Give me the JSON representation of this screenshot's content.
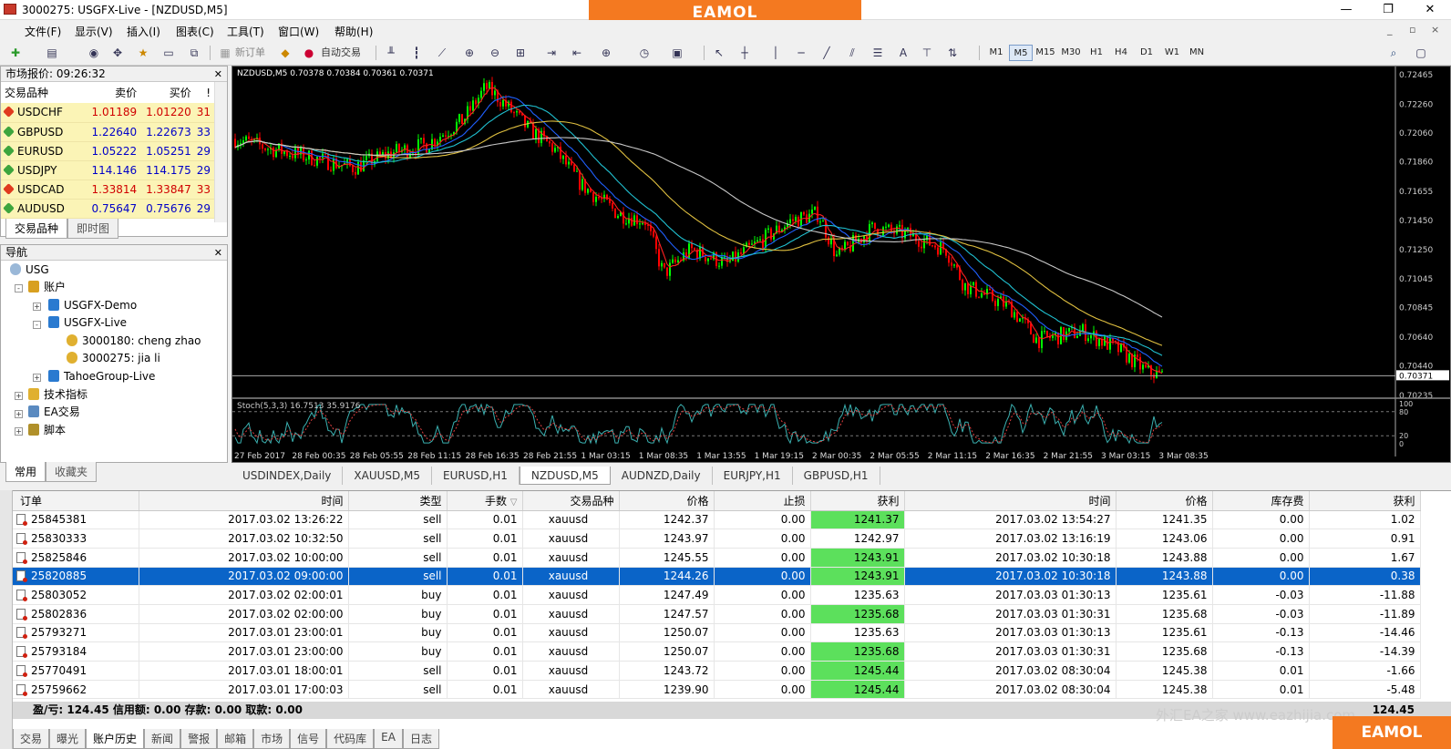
{
  "window": {
    "title": "3000275: USGFX-Live - [NZDUSD,M5]",
    "brand": "EAMOL",
    "min": "—",
    "restore": "❐",
    "close": "✕"
  },
  "menu": [
    "文件(F)",
    "显示(V)",
    "插入(I)",
    "图表(C)",
    "工具(T)",
    "窗口(W)",
    "帮助(H)"
  ],
  "mdi": [
    "_",
    "▫",
    "×"
  ],
  "toolbar": {
    "new_order": "新订单",
    "auto_trading": "自动交易",
    "text_tool": "A",
    "timeframes": [
      "M1",
      "M5",
      "M15",
      "M30",
      "H1",
      "H4",
      "D1",
      "W1",
      "MN"
    ],
    "active_timeframe": "M5"
  },
  "market_watch": {
    "title": "市场报价: 09:26:32",
    "headers": [
      "交易品种",
      "卖价",
      "买价",
      "!"
    ],
    "rows": [
      {
        "symbol": "USDCHF",
        "bid": "1.01189",
        "ask": "1.01220",
        "spread": "31",
        "dir": "down"
      },
      {
        "symbol": "GBPUSD",
        "bid": "1.22640",
        "ask": "1.22673",
        "spread": "33",
        "dir": "up"
      },
      {
        "symbol": "EURUSD",
        "bid": "1.05222",
        "ask": "1.05251",
        "spread": "29",
        "dir": "up"
      },
      {
        "symbol": "USDJPY",
        "bid": "114.146",
        "ask": "114.175",
        "spread": "29",
        "dir": "up"
      },
      {
        "symbol": "USDCAD",
        "bid": "1.33814",
        "ask": "1.33847",
        "spread": "33",
        "dir": "down"
      },
      {
        "symbol": "AUDUSD",
        "bid": "0.75647",
        "ask": "0.75676",
        "spread": "29",
        "dir": "up"
      }
    ],
    "tabs": [
      "交易品种",
      "即时图"
    ]
  },
  "navigator": {
    "title": "导航",
    "items": [
      "USG",
      "账户",
      "USGFX-Demo",
      "USGFX-Live",
      "3000180: cheng zhao",
      "3000275: jia li",
      "TahoeGroup-Live",
      "技术指标",
      "EA交易",
      "脚本"
    ],
    "tabs": [
      "常用",
      "收藏夹"
    ]
  },
  "chart": {
    "header": "NZDUSD,M5  0.70378 0.70384 0.70361 0.70371",
    "stoch_label": "Stoch(5,3,3) 16.7513 35.9176",
    "price_labels": [
      "0.72465",
      "0.72260",
      "0.72060",
      "0.71860",
      "0.71655",
      "0.71450",
      "0.71250",
      "0.71045",
      "0.70845",
      "0.70640",
      "0.70440",
      "0.70235"
    ],
    "current_price": "0.70371",
    "stoch_levels": [
      "100",
      "80",
      "20",
      "0"
    ],
    "time_labels": [
      "27 Feb 2017",
      "28 Feb 00:35",
      "28 Feb 05:55",
      "28 Feb 11:15",
      "28 Feb 16:35",
      "28 Feb 21:55",
      "1 Mar 03:15",
      "1 Mar 08:35",
      "1 Mar 13:55",
      "1 Mar 19:15",
      "2 Mar 00:35",
      "2 Mar 05:55",
      "2 Mar 11:15",
      "2 Mar 16:35",
      "2 Mar 21:55",
      "3 Mar 03:15",
      "3 Mar 08:35"
    ],
    "up_color": "#00ff00",
    "down_color": "#ff0000",
    "ma_colors": [
      "#ff2020",
      "#2060ff",
      "#20c0d0",
      "#e0c040",
      "#c8c8c8"
    ]
  },
  "chart_tabs": [
    "USDINDEX,Daily",
    "XAUUSD,M5",
    "EURUSD,H1",
    "NZDUSD,M5",
    "AUDNZD,Daily",
    "EURJPY,H1",
    "GBPUSD,H1"
  ],
  "active_chart_tab": "NZDUSD,M5",
  "terminal": {
    "headers": [
      "订单",
      "时间",
      "类型",
      "手数",
      "交易品种",
      "价格",
      "止损",
      "获利",
      "时间",
      "价格",
      "库存费",
      "获利"
    ],
    "sort_mark": "▽",
    "rows": [
      {
        "order": "25845381",
        "open_time": "2017.03.02 13:26:22",
        "type": "sell",
        "lots": "0.01",
        "symbol": "xauusd",
        "open_price": "1242.37",
        "sl": "0.00",
        "tp": "1241.37",
        "close_time": "2017.03.02 13:54:27",
        "close_price": "1241.35",
        "swap": "0.00",
        "profit": "1.02",
        "hl": true
      },
      {
        "order": "25830333",
        "open_time": "2017.03.02 10:32:50",
        "type": "sell",
        "lots": "0.01",
        "symbol": "xauusd",
        "open_price": "1243.97",
        "sl": "0.00",
        "tp": "1242.97",
        "close_time": "2017.03.02 13:16:19",
        "close_price": "1243.06",
        "swap": "0.00",
        "profit": "0.91",
        "hl": false
      },
      {
        "order": "25825846",
        "open_time": "2017.03.02 10:00:00",
        "type": "sell",
        "lots": "0.01",
        "symbol": "xauusd",
        "open_price": "1245.55",
        "sl": "0.00",
        "tp": "1243.91",
        "close_time": "2017.03.02 10:30:18",
        "close_price": "1243.88",
        "swap": "0.00",
        "profit": "1.67",
        "hl": true
      },
      {
        "order": "25820885",
        "open_time": "2017.03.02 09:00:00",
        "type": "sell",
        "lots": "0.01",
        "symbol": "xauusd",
        "open_price": "1244.26",
        "sl": "0.00",
        "tp": "1243.91",
        "close_time": "2017.03.02 10:30:18",
        "close_price": "1243.88",
        "swap": "0.00",
        "profit": "0.38",
        "hl": true,
        "selected": true
      },
      {
        "order": "25803052",
        "open_time": "2017.03.02 02:00:01",
        "type": "buy",
        "lots": "0.01",
        "symbol": "xauusd",
        "open_price": "1247.49",
        "sl": "0.00",
        "tp": "1235.63",
        "close_time": "2017.03.03 01:30:13",
        "close_price": "1235.61",
        "swap": "-0.03",
        "profit": "-11.88",
        "hl": false
      },
      {
        "order": "25802836",
        "open_time": "2017.03.02 02:00:00",
        "type": "buy",
        "lots": "0.01",
        "symbol": "xauusd",
        "open_price": "1247.57",
        "sl": "0.00",
        "tp": "1235.68",
        "close_time": "2017.03.03 01:30:31",
        "close_price": "1235.68",
        "swap": "-0.03",
        "profit": "-11.89",
        "hl": true
      },
      {
        "order": "25793271",
        "open_time": "2017.03.01 23:00:01",
        "type": "buy",
        "lots": "0.01",
        "symbol": "xauusd",
        "open_price": "1250.07",
        "sl": "0.00",
        "tp": "1235.63",
        "close_time": "2017.03.03 01:30:13",
        "close_price": "1235.61",
        "swap": "-0.13",
        "profit": "-14.46",
        "hl": false
      },
      {
        "order": "25793184",
        "open_time": "2017.03.01 23:00:00",
        "type": "buy",
        "lots": "0.01",
        "symbol": "xauusd",
        "open_price": "1250.07",
        "sl": "0.00",
        "tp": "1235.68",
        "close_time": "2017.03.03 01:30:31",
        "close_price": "1235.68",
        "swap": "-0.13",
        "profit": "-14.39",
        "hl": true
      },
      {
        "order": "25770491",
        "open_time": "2017.03.01 18:00:01",
        "type": "sell",
        "lots": "0.01",
        "symbol": "xauusd",
        "open_price": "1243.72",
        "sl": "0.00",
        "tp": "1245.44",
        "close_time": "2017.03.02 08:30:04",
        "close_price": "1245.38",
        "swap": "0.01",
        "profit": "-1.66",
        "hl": true
      },
      {
        "order": "25759662",
        "open_time": "2017.03.01 17:00:03",
        "type": "sell",
        "lots": "0.01",
        "symbol": "xauusd",
        "open_price": "1239.90",
        "sl": "0.00",
        "tp": "1245.44",
        "close_time": "2017.03.02 08:30:04",
        "close_price": "1245.38",
        "swap": "0.01",
        "profit": "-5.48",
        "hl": true
      }
    ],
    "summary": "盈/亏: 124.45  信用额: 0.00  存款: 0.00  取款: 0.00",
    "summary_total": "124.45",
    "tabs": [
      "交易",
      "曝光",
      "账户历史",
      "新闻",
      "警报",
      "邮箱",
      "市场",
      "信号",
      "代码库",
      "EA",
      "日志"
    ],
    "active_tab": "账户历史"
  },
  "watermark": "外汇EA之家 www.eazhijia.com"
}
